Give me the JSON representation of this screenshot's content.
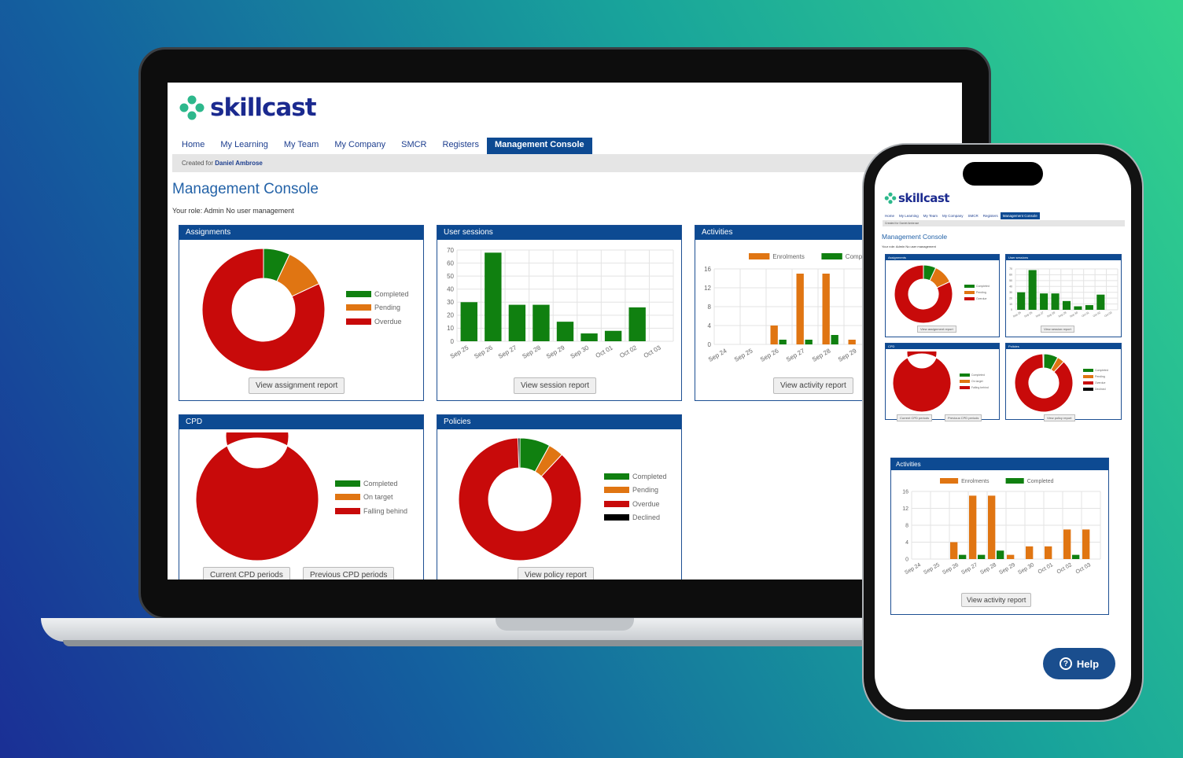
{
  "brand": {
    "name": "skillcast"
  },
  "nav": [
    "Home",
    "My Learning",
    "My Team",
    "My Company",
    "SMCR",
    "Registers",
    "Management Console"
  ],
  "nav_active": 6,
  "created_for": {
    "label": "Created for",
    "name": "Daniel Ambrose"
  },
  "page": {
    "title": "Management Console",
    "role": "Your role: Admin No user management"
  },
  "panels": {
    "assignments": {
      "title": "Assignments",
      "button": "View assignment report"
    },
    "sessions": {
      "title": "User sessions",
      "button": "View session report"
    },
    "activities": {
      "title": "Activities",
      "button": "View activity report"
    },
    "cpd": {
      "title": "CPD",
      "button1": "Current CPD periods",
      "button2": "Previous CPD periods"
    },
    "policies": {
      "title": "Policies",
      "button": "View policy report"
    }
  },
  "help": {
    "label": "Help",
    "icon": "question-circle-icon"
  },
  "colors": {
    "green": "#108010",
    "orange": "#e07512",
    "red": "#c80a0a",
    "black": "#000000",
    "brand": "#0d4a92"
  },
  "chart_data": [
    {
      "type": "pie",
      "name": "Assignments",
      "donut": true,
      "labels": [
        "Completed",
        "Pending",
        "Overdue"
      ],
      "values": [
        7,
        11,
        82
      ],
      "colors": [
        "#108010",
        "#e07512",
        "#c80a0a"
      ]
    },
    {
      "type": "bar",
      "name": "User sessions",
      "categories": [
        "Sep 25",
        "Sep 26",
        "Sep 27",
        "Sep 28",
        "Sep 29",
        "Sep 30",
        "Oct 01",
        "Oct 02",
        "Oct 03"
      ],
      "values": [
        30,
        68,
        28,
        28,
        15,
        6,
        8,
        26
      ],
      "ylim": [
        0,
        70
      ],
      "yticks": [
        0,
        10,
        20,
        30,
        40,
        50,
        60,
        70
      ],
      "color": "#108010"
    },
    {
      "type": "bar",
      "name": "Activities",
      "categories": [
        "Sep 24",
        "Sep 25",
        "Sep 26",
        "Sep 27",
        "Sep 28",
        "Sep 29",
        "Sep 30",
        "Oct 01",
        "Oct 02",
        "Oct 03"
      ],
      "series": [
        {
          "name": "Enrolments",
          "values": [
            0,
            0,
            4,
            15,
            15,
            1,
            3,
            3,
            7,
            7
          ],
          "color": "#e07512"
        },
        {
          "name": "Completed",
          "values": [
            0,
            0,
            1,
            1,
            2,
            0,
            0,
            0,
            1,
            0
          ],
          "color": "#108010"
        }
      ],
      "ylim": [
        0,
        16
      ],
      "yticks": [
        0,
        4,
        8,
        12,
        16
      ]
    },
    {
      "type": "pie",
      "name": "CPD",
      "donut": true,
      "labels": [
        "Completed",
        "On target",
        "Falling behind"
      ],
      "values": [
        0,
        0,
        100
      ],
      "colors": [
        "#108010",
        "#e07512",
        "#c80a0a"
      ]
    },
    {
      "type": "pie",
      "name": "Policies",
      "donut": true,
      "labels": [
        "Completed",
        "Pending",
        "Overdue",
        "Declined"
      ],
      "values": [
        8,
        4,
        87.5,
        0.5
      ],
      "colors": [
        "#108010",
        "#e07512",
        "#c80a0a",
        "#000000"
      ]
    }
  ]
}
